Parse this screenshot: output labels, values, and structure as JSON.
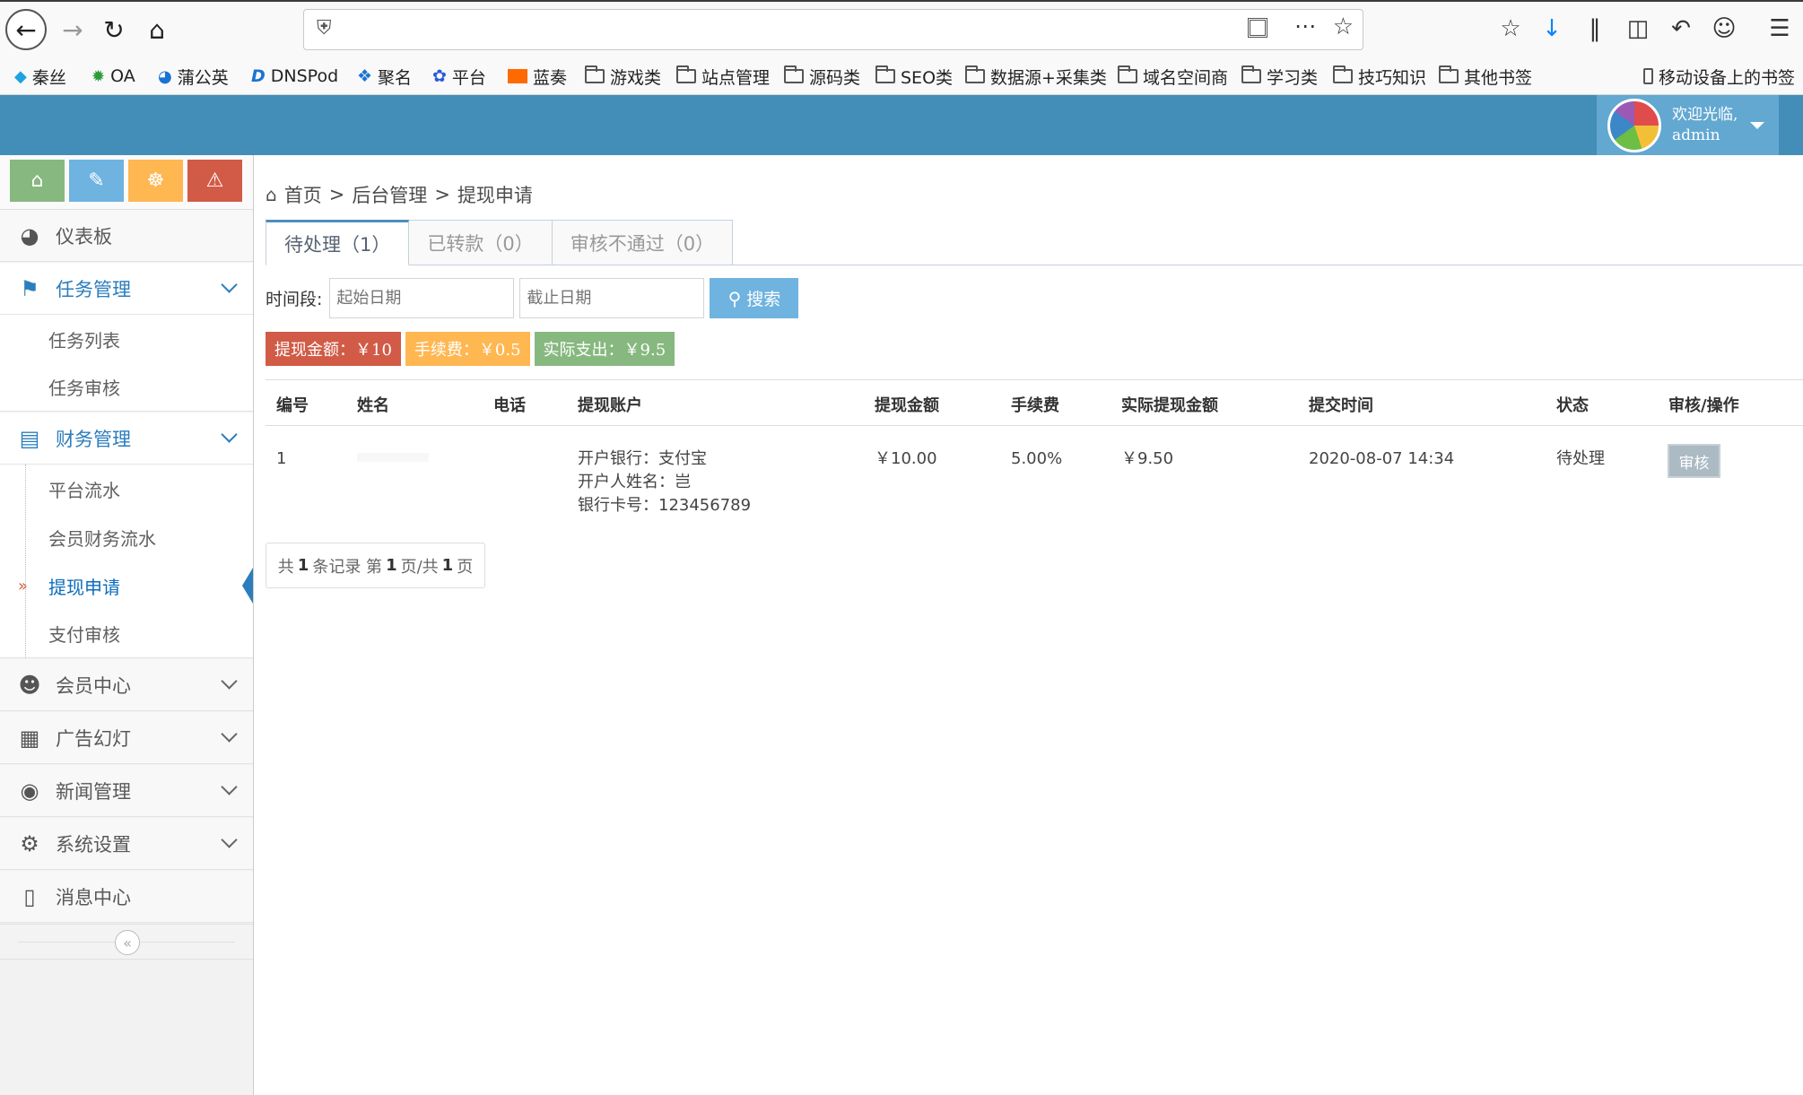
{
  "browser": {
    "bookmarks": [
      "秦丝",
      "OA",
      "蒲公英",
      "DNSPod",
      "聚名",
      "平台",
      "蓝奏",
      "游戏类",
      "站点管理",
      "源码类",
      "SEO类",
      "数据源+采集类",
      "域名空间商",
      "学习类",
      "技巧知识",
      "其他书签"
    ],
    "mobile_bookmarks": "移动设备上的书签"
  },
  "header": {
    "welcome": "欢迎光临,",
    "user": "admin"
  },
  "sidebar": {
    "menus": {
      "dashboard": "仪表板",
      "task": "任务管理",
      "finance": "财务管理",
      "member": "会员中心",
      "ads": "广告幻灯",
      "news": "新闻管理",
      "settings": "系统设置",
      "messages": "消息中心"
    },
    "task_items": [
      "任务列表",
      "任务审核"
    ],
    "finance_items": [
      "平台流水",
      "会员财务流水",
      "提现申请",
      "支付审核"
    ]
  },
  "breadcrumb": [
    "首页",
    "后台管理",
    "提现申请"
  ],
  "tabs": [
    "待处理（1）",
    "已转款（0）",
    "审核不通过（0）"
  ],
  "search": {
    "label": "时间段:",
    "start_placeholder": "起始日期",
    "end_placeholder": "截止日期",
    "button": "搜索"
  },
  "stats": {
    "amount": "提现金额：￥10",
    "fee": "手续费：￥0.5",
    "actual": "实际支出：￥9.5",
    "colors": {
      "amount": "#d15b47",
      "fee": "#f89406",
      "actual": "#82af6f"
    }
  },
  "table": {
    "headers": [
      "编号",
      "姓名",
      "电话",
      "提现账户",
      "提现金额",
      "手续费",
      "实际提现金额",
      "提交时间",
      "状态",
      "审核/操作"
    ],
    "rows": [
      {
        "id": "1",
        "name": "",
        "phone": "",
        "account_bank": "开户银行：支付宝",
        "account_holder": "开户人姓名：岂",
        "account_card": "银行卡号：123456789",
        "amount": "￥10.00",
        "fee": "5.00%",
        "actual": "￥9.50",
        "time": "2020-08-07 14:34",
        "status": "待处理",
        "action": "审核"
      }
    ]
  },
  "pager": {
    "pre": "共",
    "total": "1",
    "mid1": "条记录 第",
    "page": "1",
    "mid2": "页/共",
    "pages": "1",
    "post": "页"
  }
}
